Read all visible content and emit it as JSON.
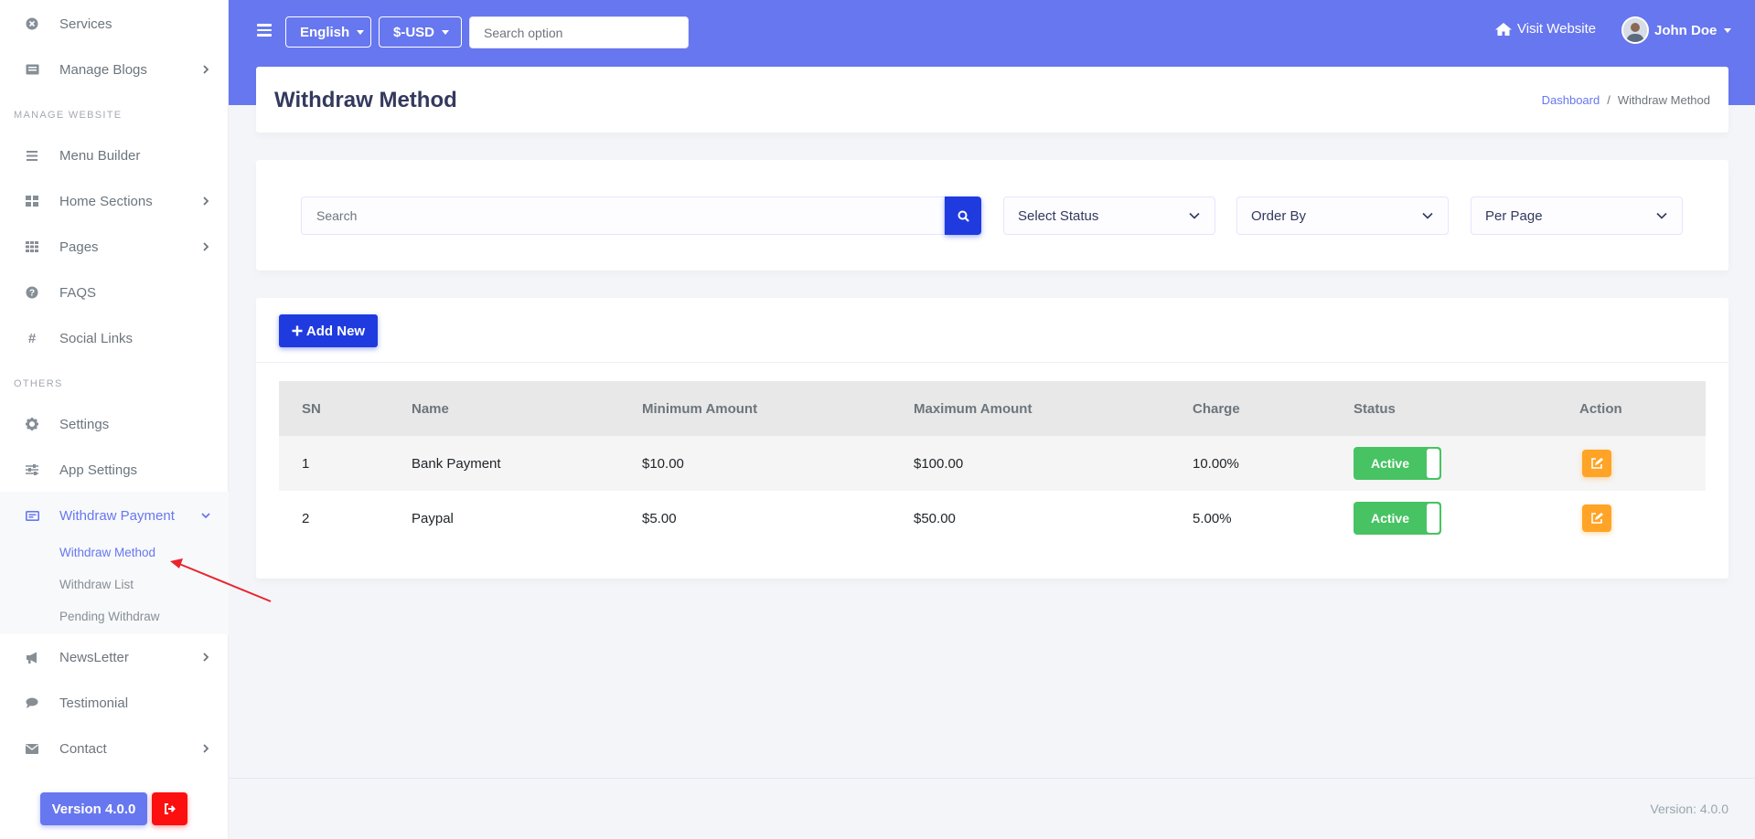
{
  "sidebar": {
    "items_top": [
      {
        "label": "Services",
        "icon": "times-circle-icon"
      },
      {
        "label": "Manage Blogs",
        "icon": "newspaper-icon",
        "has_sub": true
      }
    ],
    "section_manage": "MANAGE WEBSITE",
    "items_manage": [
      {
        "label": "Menu Builder",
        "icon": "bars-icon"
      },
      {
        "label": "Home Sections",
        "icon": "th-large-icon",
        "has_sub": true
      },
      {
        "label": "Pages",
        "icon": "th-icon",
        "has_sub": true
      },
      {
        "label": "FAQS",
        "icon": "question-circle-icon"
      },
      {
        "label": "Social Links",
        "icon": "hashtag-icon"
      }
    ],
    "section_others": "OTHERS",
    "items_others": [
      {
        "label": "Settings",
        "icon": "cog-icon"
      },
      {
        "label": "App Settings",
        "icon": "sliders-icon"
      },
      {
        "label": "Withdraw Payment",
        "icon": "money-bill-icon",
        "active": true
      }
    ],
    "sub_items": [
      {
        "label": "Withdraw Method",
        "active": true
      },
      {
        "label": "Withdraw List"
      },
      {
        "label": "Pending Withdraw"
      }
    ],
    "items_bottom": [
      {
        "label": "NewsLetter",
        "icon": "bullhorn-icon",
        "has_sub": true
      },
      {
        "label": "Testimonial",
        "icon": "comment-icon"
      },
      {
        "label": "Contact",
        "icon": "envelope-icon",
        "has_sub": true
      }
    ],
    "version_label": "Version 4.0.0"
  },
  "topbar": {
    "language": "English",
    "currency": "$-USD",
    "search_placeholder": "Search option",
    "visit_website": "Visit Website",
    "user_name": "John Doe"
  },
  "header": {
    "title": "Withdraw Method",
    "breadcrumb_home": "Dashboard",
    "breadcrumb_current": "Withdraw Method"
  },
  "filters": {
    "search_placeholder": "Search",
    "status": "Select Status",
    "order_by": "Order By",
    "per_page": "Per Page"
  },
  "table": {
    "add_label": "Add New",
    "columns": [
      "SN",
      "Name",
      "Minimum Amount",
      "Maximum Amount",
      "Charge",
      "Status",
      "Action"
    ],
    "rows": [
      {
        "sn": "1",
        "name": "Bank Payment",
        "min": "$10.00",
        "max": "$100.00",
        "charge": "10.00%",
        "status": "Active"
      },
      {
        "sn": "2",
        "name": "Paypal",
        "min": "$5.00",
        "max": "$50.00",
        "charge": "5.00%",
        "status": "Active"
      }
    ]
  },
  "footer": {
    "text": "Version: 4.0.0"
  },
  "colors": {
    "primary": "#6777ef",
    "button_blue": "#1f3be0",
    "success": "#47c363",
    "warning": "#ffa426",
    "danger": "#fc0f0f"
  }
}
